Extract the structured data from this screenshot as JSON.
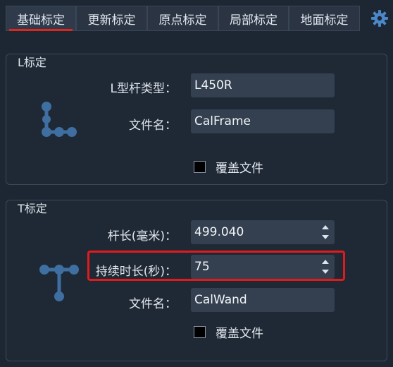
{
  "tabs": [
    {
      "label": "基础标定",
      "active": true
    },
    {
      "label": "更新标定",
      "active": false
    },
    {
      "label": "原点标定",
      "active": false
    },
    {
      "label": "局部标定",
      "active": false
    },
    {
      "label": "地面标定",
      "active": false
    }
  ],
  "settings_icon": "gear-icon",
  "l_section": {
    "title": "L标定",
    "icon": "l-frame-icon",
    "rod_type_label": "L型杆类型：",
    "rod_type_value": "L450R",
    "file_name_label": "文件名：",
    "file_name_value": "CalFrame",
    "overwrite_label": "覆盖文件",
    "overwrite_checked": false
  },
  "t_section": {
    "title": "T标定",
    "icon": "t-wand-icon",
    "rod_length_label": "杆长(毫米)：",
    "rod_length_value": "499.040",
    "duration_label": "持续时长(秒)：",
    "duration_value": "75",
    "file_name_label": "文件名：",
    "file_name_value": "CalWand",
    "overwrite_label": "覆盖文件",
    "overwrite_checked": false
  },
  "colors": {
    "background": "#1d2733",
    "active_tab_underline": "#e0251d",
    "highlight_box": "#e11b1b",
    "icon_blue": "#3f6ea0"
  }
}
